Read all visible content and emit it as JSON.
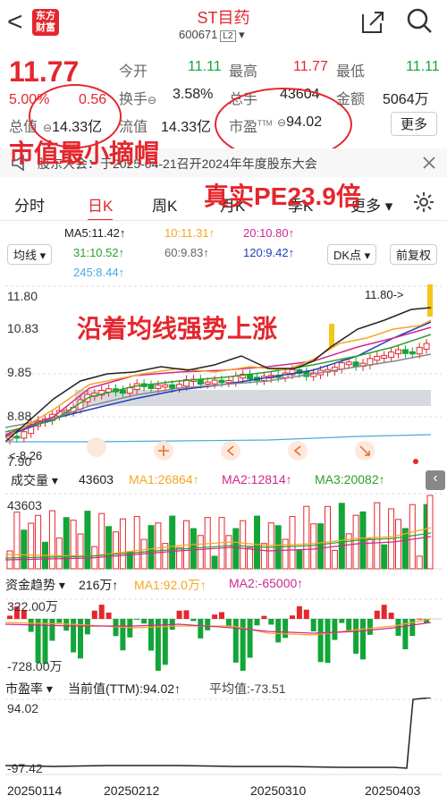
{
  "header": {
    "back": "<",
    "logo_line1": "东方",
    "logo_line2": "财富",
    "title": "ST目药",
    "code": "600671",
    "level": "L2"
  },
  "quote": {
    "price": "11.77",
    "change_pct": "5.00%",
    "change": "0.56",
    "open_label": "今开",
    "open": "11.11",
    "high_label": "最高",
    "high": "11.77",
    "low_label": "最低",
    "low": "11.11",
    "turnover_label": "换手",
    "turnover": "3.58%",
    "volume_label": "总手",
    "volume": "43604",
    "amount_label": "金额",
    "amount": "5064万",
    "mktcap_label": "总值",
    "mktcap": "14.33亿",
    "float_label": "流值",
    "float": "14.33亿",
    "pe_label": "市盈",
    "pe_sup": "TTM",
    "pe": "94.02",
    "more": "更多"
  },
  "annotations": {
    "a1": "市值最小摘帽",
    "a2": "真实PE23.9倍",
    "a3": "沿着均线强势上涨"
  },
  "notice": {
    "text": "股东大会：于2025-04-21召开2024年年度股东大会"
  },
  "tabs": [
    "分时",
    "日K",
    "周K",
    "月K",
    "季K",
    "更多"
  ],
  "ma_legend": {
    "ma5": "MA5:11.42↑",
    "ma10": "10:11.31↑",
    "ma20": "20:10.80↑",
    "ma31": "31:10.52↑",
    "ma60": "60:9.83↑",
    "ma120": "120:9.42↑",
    "ma245": "245:8.44↑"
  },
  "controls": {
    "ma_select": "均线",
    "dk": "DK点",
    "adjust": "前复权"
  },
  "kline": {
    "y_top": "11.80",
    "y2": "10.83",
    "y3": "9.85",
    "y4": "8.88",
    "y5": "7.90",
    "high_mark": "11.80",
    "low_mark": "8.26"
  },
  "volume": {
    "label": "成交量",
    "value": "43603",
    "ma1": "MA1:26864↑",
    "ma2": "MA2:12814↑",
    "ma3": "MA3:20082↑",
    "axis_top": "43603"
  },
  "flow": {
    "label": "资金趋势",
    "value": "216万↑",
    "ma1": "MA1:92.0万↑",
    "ma2": "MA2:-65000↑",
    "axis_top": "322.00万",
    "axis_bottom": "-728.00万"
  },
  "pe_panel": {
    "label": "市盈率",
    "current": "当前值(TTM):94.02↑",
    "avg": "平均值:-73.51",
    "axis_top": "94.02",
    "axis_bottom": "-97.42"
  },
  "dates": [
    "20250114",
    "20250212",
    "20250310",
    "20250403"
  ],
  "colors": {
    "up": "#e5262d",
    "down": "#13a538",
    "ma5": "#222222",
    "ma10": "#f5a623",
    "ma20": "#d0288c",
    "ma31": "#2ca02c",
    "ma60": "#888888",
    "ma120": "#1f3fbf",
    "ma245": "#4aa8e0"
  }
}
